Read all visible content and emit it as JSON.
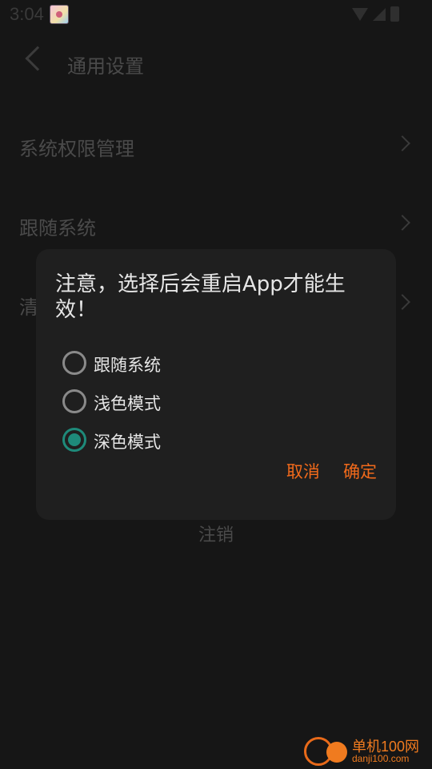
{
  "status_bar": {
    "time": "3:04"
  },
  "app_bar": {
    "title": "通用设置"
  },
  "list": {
    "items": [
      {
        "label": "系统权限管理"
      },
      {
        "label": "跟随系统"
      },
      {
        "label": "清"
      }
    ],
    "logout": "注销"
  },
  "dialog": {
    "title": "注意，选择后会重启App才能生效！",
    "options": [
      {
        "label": "跟随系统",
        "selected": false
      },
      {
        "label": "浅色模式",
        "selected": false
      },
      {
        "label": "深色模式",
        "selected": true
      }
    ],
    "cancel_label": "取消",
    "confirm_label": "确定"
  },
  "watermark": {
    "brand": "单机100网",
    "domain": "danji100.com"
  },
  "colors": {
    "accent": "#f26a1b",
    "radio_selected": "#1e8a7a"
  }
}
